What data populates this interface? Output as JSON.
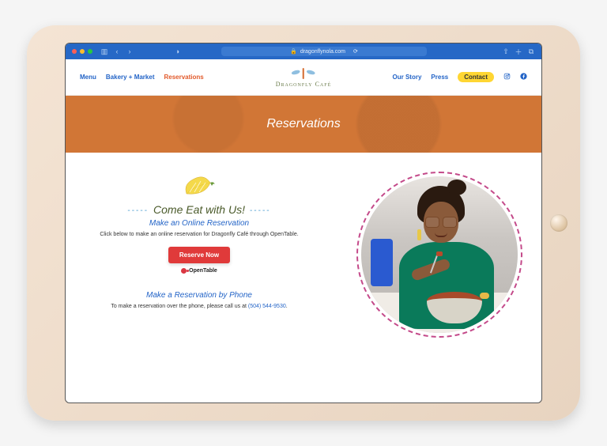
{
  "browser": {
    "url": "dragonflynola.com"
  },
  "nav": {
    "left": [
      "Menu",
      "Bakery + Market",
      "Reservations"
    ],
    "active_index": 2,
    "right": [
      "Our Story",
      "Press"
    ],
    "contact_label": "Contact"
  },
  "logo": {
    "text": "Dragonfly Café"
  },
  "hero": {
    "title": "Reservations"
  },
  "sections": {
    "eat_heading": "Come Eat with Us!",
    "online": {
      "heading": "Make an Online Reservation",
      "body": "Click below to make an online reservation for Dragonfly Café through OpenTable.",
      "button": "Reserve Now",
      "partner": "OpenTable"
    },
    "phone": {
      "heading": "Make a Reservation by Phone",
      "body_prefix": "To make a reservation over the phone, please call us at ",
      "phone_number": "(504) 544-9530",
      "body_suffix": "."
    }
  }
}
